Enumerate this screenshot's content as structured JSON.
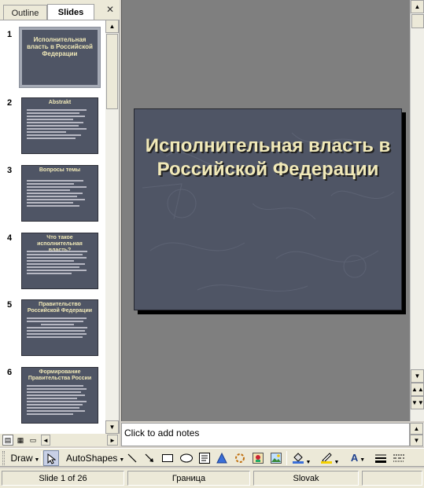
{
  "tabs": {
    "outline": "Outline",
    "slides": "Slides",
    "close_glyph": "✕"
  },
  "slides": [
    {
      "number": "1",
      "title": "Исполнительная власть в Российской Федерации",
      "selected": true
    },
    {
      "number": "2",
      "title": "Аbstrakt",
      "bullets": 9
    },
    {
      "number": "3",
      "title": "Вопросы темы",
      "bullets": 8
    },
    {
      "number": "4",
      "title": "Что такое исполнительная власть?",
      "bullets": 8
    },
    {
      "number": "5",
      "title": "Правительство Российской Федерации",
      "bullets": 7
    },
    {
      "number": "6",
      "title": "Формирование Правительства России",
      "bullets": 10
    }
  ],
  "main_slide": {
    "title": "Исполнительная власть в Российской Федерации"
  },
  "notes": {
    "placeholder": "Click to add notes"
  },
  "toolbar": {
    "draw_label": "Draw",
    "autoshapes_label": "AutoShapes",
    "icons": [
      "select-pointer-icon",
      "line-icon",
      "arrow-icon",
      "rectangle-icon",
      "oval-icon",
      "text-box-icon",
      "wordart-icon",
      "diagram-icon",
      "clip-art-icon",
      "picture-icon",
      "fill-color-icon",
      "line-color-icon",
      "font-color-icon",
      "line-style-icon",
      "dash-style-icon"
    ]
  },
  "status": {
    "slide_indicator": "Slide 1 of 26",
    "design": "Граница",
    "language": "Slovak"
  },
  "colors": {
    "slide_bg": "#4f5565",
    "slide_title": "#f1e9b8",
    "canvas_bg": "#7f7f7f"
  }
}
